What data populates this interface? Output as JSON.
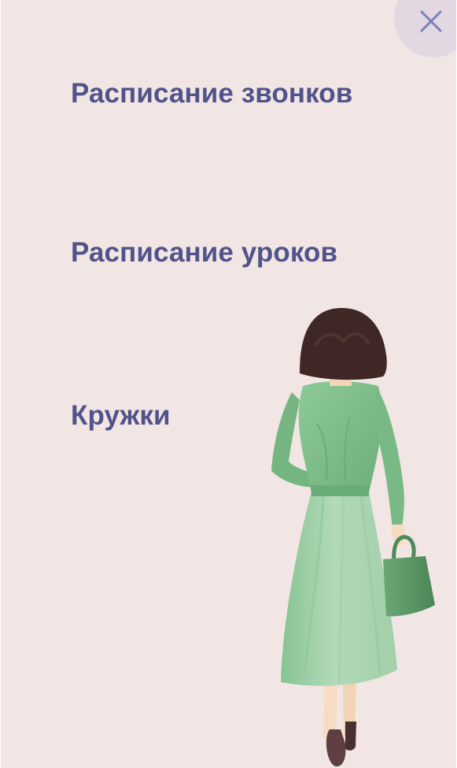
{
  "close_button": {
    "icon": "close-icon",
    "bg_color": "#e3d8e2",
    "icon_color": "#7a7fc0"
  },
  "menu": {
    "text_color": "#51538a",
    "items": [
      {
        "label": "Расписание звонков"
      },
      {
        "label": "Расписание уроков"
      },
      {
        "label": "Кружки"
      }
    ]
  },
  "illustration": {
    "subject": "woman-walking-illustration",
    "colors": {
      "hair": "#3e2724",
      "dress_top": "#7fbd8b",
      "dress_skirt": "#a9d3b0",
      "bag": "#5b9866",
      "skin": "#f6dcc0",
      "shoes": "#5a3b3d",
      "background": "#f1e6e4"
    }
  }
}
